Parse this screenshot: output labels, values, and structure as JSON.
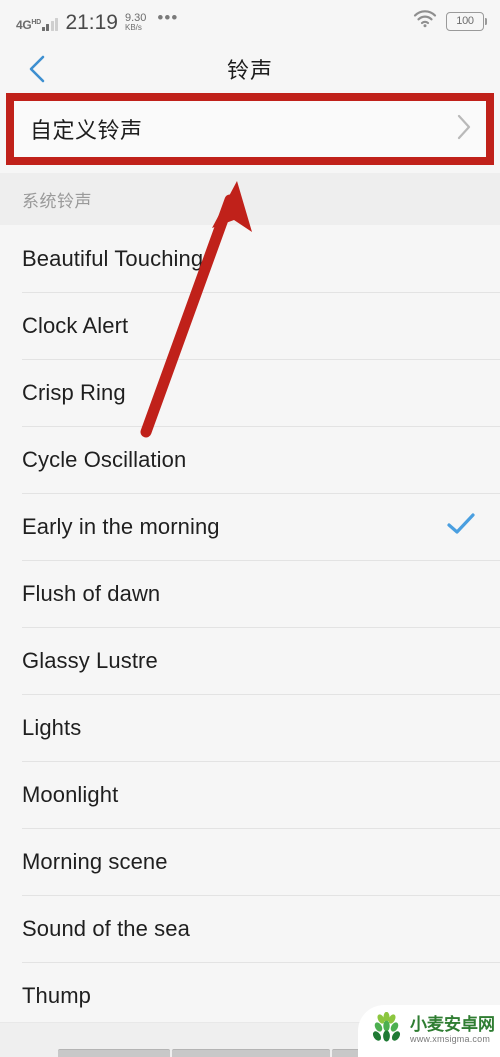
{
  "status_bar": {
    "network_type": "4G",
    "network_suffix": "HD",
    "time": "21:19",
    "data_speed_value": "9.30",
    "data_speed_unit": "KB/s",
    "more_icon": "•••",
    "battery_percent": "100"
  },
  "header": {
    "back_label": "back",
    "title": "铃声"
  },
  "custom_ringtone": {
    "label": "自定义铃声",
    "chevron": "chevron-right"
  },
  "section": {
    "title": "系统铃声"
  },
  "ringtones": [
    {
      "name": "Beautiful Touching",
      "selected": false
    },
    {
      "name": "Clock Alert",
      "selected": false
    },
    {
      "name": "Crisp Ring",
      "selected": false
    },
    {
      "name": "Cycle Oscillation",
      "selected": false
    },
    {
      "name": "Early in the morning",
      "selected": true
    },
    {
      "name": "Flush of dawn",
      "selected": false
    },
    {
      "name": "Glassy Lustre",
      "selected": false
    },
    {
      "name": "Lights",
      "selected": false
    },
    {
      "name": "Moonlight",
      "selected": false
    },
    {
      "name": "Morning scene",
      "selected": false
    },
    {
      "name": "Sound of the sea",
      "selected": false
    },
    {
      "name": "Thump",
      "selected": false
    }
  ],
  "annotations": {
    "highlight_color": "#c0211a",
    "arrow_color": "#c0211a",
    "accent_color": "#4a9fe0"
  },
  "watermark": {
    "title": "小麦安卓网",
    "url": "www.xmsigma.com"
  }
}
